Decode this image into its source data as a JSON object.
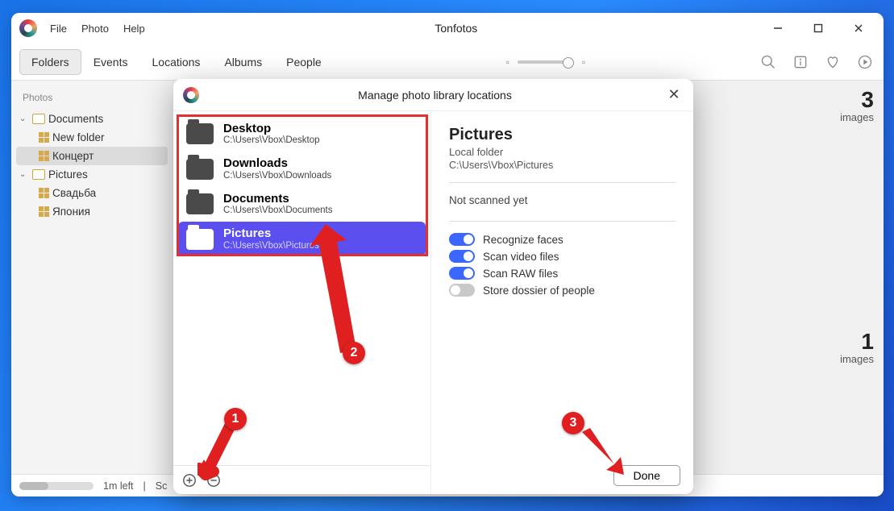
{
  "app": {
    "title": "Tonfotos"
  },
  "menu": {
    "file": "File",
    "photo": "Photo",
    "help": "Help"
  },
  "tabs": {
    "folders": "Folders",
    "events": "Events",
    "locations": "Locations",
    "albums": "Albums",
    "people": "People"
  },
  "sidebar": {
    "heading": "Photos",
    "documents": "Documents",
    "new_folder": "New folder",
    "concert": "Концерт",
    "pictures": "Pictures",
    "wedding": "Свадьба",
    "japan": "Япония"
  },
  "counts": {
    "n1": "3",
    "lbl1": "images",
    "n2": "1",
    "lbl2": "images"
  },
  "status": {
    "left": "1m left",
    "scan": "Sc"
  },
  "modal": {
    "title": "Manage photo library locations",
    "locations": [
      {
        "name": "Desktop",
        "path": "C:\\Users\\Vbox\\Desktop"
      },
      {
        "name": "Downloads",
        "path": "C:\\Users\\Vbox\\Downloads"
      },
      {
        "name": "Documents",
        "path": "C:\\Users\\Vbox\\Documents"
      },
      {
        "name": "Pictures",
        "path": "C:\\Users\\Vbox\\Pictures"
      }
    ],
    "details": {
      "title": "Pictures",
      "subtitle": "Local folder",
      "path": "C:\\Users\\Vbox\\Pictures",
      "scan_status": "Not scanned yet",
      "opt_faces": "Recognize faces",
      "opt_video": "Scan video files",
      "opt_raw": "Scan RAW files",
      "opt_dossier": "Store dossier of people"
    },
    "done": "Done"
  },
  "markers": {
    "m1": "1",
    "m2": "2",
    "m3": "3"
  }
}
